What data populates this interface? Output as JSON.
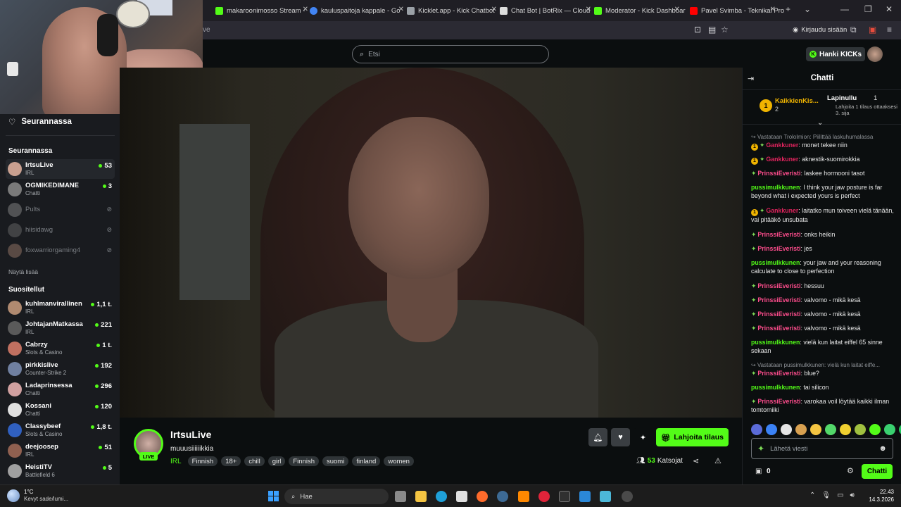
{
  "browser": {
    "tabs": [
      {
        "label": "makaroonimosso Stream -",
        "color": "#53fc18"
      },
      {
        "label": "kauluspaitoja kappale - Go",
        "color": "#4285f4"
      },
      {
        "label": "Kicklet.app - Kick Chatbot",
        "color": "#9aa0a6"
      },
      {
        "label": "Chat Bot | BotRix — Cloud",
        "color": "#dddddd"
      },
      {
        "label": "Moderator - Kick Dashboar",
        "color": "#53fc18"
      },
      {
        "label": "Pavel Svimba - Teknikal Pro",
        "color": "#ff0000"
      }
    ],
    "url_tail": "ve",
    "signin_label": "Kirjaudu sisään"
  },
  "header": {
    "search_placeholder": "Etsi",
    "get_kicks_label": "Hanki KICKs"
  },
  "sidebar": {
    "following_header": "Seurannassa",
    "following_title": "Seurannassa",
    "following": [
      {
        "name": "IrtsuLive",
        "category": "IRL",
        "viewers": "53",
        "online": true,
        "color": "#c9a090"
      },
      {
        "name": "OGMIKEDIMANE",
        "category": "Chatti",
        "viewers": "3",
        "online": true,
        "color": "#7a7a7a"
      },
      {
        "name": "Pults",
        "category": "",
        "viewers": "",
        "online": false,
        "color": "#8a8a8a"
      },
      {
        "name": "hiisidawg",
        "category": "",
        "viewers": "",
        "online": false,
        "color": "#6a6a6a"
      },
      {
        "name": "foxwarriorgaming4",
        "category": "",
        "viewers": "",
        "online": false,
        "color": "#9a7a6a"
      }
    ],
    "show_more": "Näytä lisää",
    "recommended_title": "Suositellut",
    "recommended": [
      {
        "name": "kuhlmanvirallinen",
        "category": "IRL",
        "viewers": "1,1 t.",
        "color": "#b08a70"
      },
      {
        "name": "JohtajanMatkassa",
        "category": "IRL",
        "viewers": "221",
        "color": "#5a5a5a"
      },
      {
        "name": "Cabrzy",
        "category": "Slots & Casino",
        "viewers": "1 t.",
        "color": "#c07060"
      },
      {
        "name": "pirkkislive",
        "category": "Counter-Strike 2",
        "viewers": "192",
        "color": "#7080a0"
      },
      {
        "name": "Ladaprinsessa",
        "category": "Chatti",
        "viewers": "296",
        "color": "#d0a0a0"
      },
      {
        "name": "Kossani",
        "category": "Chatti",
        "viewers": "120",
        "color": "#e0e0e0"
      },
      {
        "name": "Classybeef",
        "category": "Slots & Casino",
        "viewers": "1,8 t.",
        "color": "#3060c0"
      },
      {
        "name": "deejoosep",
        "category": "IRL",
        "viewers": "51",
        "color": "#906050"
      },
      {
        "name": "HeistiTV",
        "category": "Battlefield 6",
        "viewers": "5",
        "color": "#a0a0a0"
      }
    ]
  },
  "stream": {
    "live_label": "LIVE",
    "name": "IrtsuLive",
    "title": "muuusiiiiiikkia",
    "category": "IRL",
    "tags": [
      "Finnish",
      "18+",
      "chill",
      "girl",
      "Finnish",
      "suomi",
      "finland",
      "women"
    ],
    "gift_label": "Lahjoita tilaus",
    "viewer_count": "53",
    "viewer_label": "Katsojat"
  },
  "chat": {
    "title": "Chatti",
    "leader_rank": "1",
    "leader_name": "KaikkienKis...",
    "leader_count": "2",
    "top_gifter": "Lapinullu",
    "top_gifter_count": "1",
    "top_gifter_sub": "Lahjoita 1 tilaus ottaaksesi 3. sija",
    "messages": [
      {
        "type": "reply",
        "text": "↪ Vastataan Trololmion: Piilittää laskuhumalassa"
      },
      {
        "type": "msg",
        "badge": "1",
        "spark": true,
        "user": "Gankkuner",
        "ucolor": "#e0245e",
        "text": "monet tekee niin"
      },
      {
        "type": "msg",
        "badge": "1",
        "spark": true,
        "user": "Gankkuner",
        "ucolor": "#e0245e",
        "text": "aknestik-suomirokkia"
      },
      {
        "type": "msg",
        "badge": "",
        "spark": true,
        "user": "PrinssiEveristi",
        "ucolor": "#ff4d8d",
        "text": "laskee hormooni tasot"
      },
      {
        "type": "msg",
        "badge": "",
        "spark": false,
        "user": "pussimulkkunen",
        "ucolor": "#53fc18",
        "text": "I think your jaw posture is far beyond what i expected yours is perfect"
      },
      {
        "type": "msg",
        "badge": "1",
        "spark": true,
        "user": "Gankkuner",
        "ucolor": "#e0245e",
        "text": "laitatko mun toiveen vielä tänään, vai pitääkö unsubata"
      },
      {
        "type": "msg",
        "badge": "",
        "spark": true,
        "user": "PrinssiEveristi",
        "ucolor": "#ff4d8d",
        "text": "onks heikin"
      },
      {
        "type": "msg",
        "badge": "",
        "spark": true,
        "user": "PrinssiEveristi",
        "ucolor": "#ff4d8d",
        "text": "jes"
      },
      {
        "type": "msg",
        "badge": "",
        "spark": false,
        "user": "pussimulkkunen",
        "ucolor": "#53fc18",
        "text": "your jaw and your reasoning calculate to close to perfection"
      },
      {
        "type": "msg",
        "badge": "",
        "spark": true,
        "user": "PrinssiEveristi",
        "ucolor": "#ff4d8d",
        "text": "hessuu"
      },
      {
        "type": "msg",
        "badge": "",
        "spark": true,
        "user": "PrinssiEveristi",
        "ucolor": "#ff4d8d",
        "text": "valvomo - mikä kesä"
      },
      {
        "type": "msg",
        "badge": "",
        "spark": true,
        "user": "PrinssiEveristi",
        "ucolor": "#ff4d8d",
        "text": "valvomo - mikä kesä"
      },
      {
        "type": "msg",
        "badge": "",
        "spark": true,
        "user": "PrinssiEveristi",
        "ucolor": "#ff4d8d",
        "text": "valvomo - mikä kesä"
      },
      {
        "type": "msg",
        "badge": "",
        "spark": false,
        "user": "pussimulkkunen",
        "ucolor": "#53fc18",
        "text": "vielä kun laitat eiffel 65 sinne sekaan"
      },
      {
        "type": "reply",
        "text": "↪ Vastataan pussimulkkunen: vielä kun laitat eiffe..."
      },
      {
        "type": "msg",
        "badge": "",
        "spark": true,
        "user": "PrinssiEveristi",
        "ucolor": "#ff4d8d",
        "text": "blue?"
      },
      {
        "type": "msg",
        "badge": "",
        "spark": false,
        "user": "pussimulkkunen",
        "ucolor": "#53fc18",
        "text": "tai silicon"
      },
      {
        "type": "msg",
        "badge": "",
        "spark": true,
        "user": "PrinssiEveristi",
        "ucolor": "#ff4d8d",
        "text": "varokaa voil löytää kaikki ilman tomtomiiki"
      }
    ],
    "input_placeholder": "Lähetä viesti",
    "points": "0",
    "send_label": "Chatti"
  },
  "taskbar": {
    "temperature": "1°C",
    "weather_text": "Kevyt sade/lumi...",
    "search_label": "Hae",
    "time": "22.43",
    "date": "14.3.2026"
  }
}
